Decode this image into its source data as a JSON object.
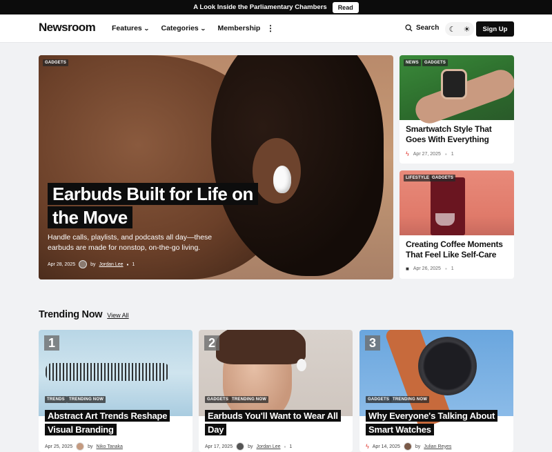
{
  "announcement": {
    "text": "A Look Inside the Parliamentary Chambers",
    "button": "Read"
  },
  "header": {
    "logo": "Newsroom",
    "nav": [
      {
        "label": "Features",
        "has_dropdown": true
      },
      {
        "label": "Categories",
        "has_dropdown": true
      },
      {
        "label": "Membership",
        "has_dropdown": false
      }
    ],
    "more_icon": "more-vertical-icon",
    "search_label": "Search",
    "signup_label": "Sign Up"
  },
  "hero": {
    "tags": [
      "GADGETS"
    ],
    "title": "Earbuds Built for Life on the Move",
    "excerpt": "Handle calls, playlists, and podcasts all day—these earbuds are made for nonstop, on-the-go living.",
    "date": "Apr 28, 2025",
    "by": "by",
    "author": "Jordan Lee",
    "comments": "1"
  },
  "side_cards": [
    {
      "tags": [
        "NEWS",
        "GADGETS"
      ],
      "title": "Smartwatch Style That Goes With Everything",
      "date": "Apr 27, 2025",
      "comments": "1",
      "icon": "bolt-icon"
    },
    {
      "tags": [
        "LIFESTYLE",
        "GADGETS"
      ],
      "title": "Creating Coffee Moments That Feel Like Self-Care",
      "date": "Apr 26, 2025",
      "comments": "1",
      "icon": "lock-icon"
    }
  ],
  "trending": {
    "title": "Trending Now",
    "view_all": "View All",
    "items": [
      {
        "num": "1",
        "tags": [
          "TRENDS",
          "TRENDING NOW"
        ],
        "title": "Abstract Art Trends Reshape Visual Branding",
        "date": "Apr 25, 2025",
        "by": "by",
        "author": "Niko Tanaka"
      },
      {
        "num": "2",
        "tags": [
          "GADGETS",
          "TRENDING NOW"
        ],
        "title": "Earbuds You'll Want to Wear All Day",
        "date": "Apr 17, 2025",
        "by": "by",
        "author": "Jordan Lee",
        "comments": "1"
      },
      {
        "num": "3",
        "tags": [
          "GADGETS",
          "TRENDING NOW"
        ],
        "title": "Why Everyone's Talking About Smart Watches",
        "date": "Apr 14, 2025",
        "by": "by",
        "author": "Julian Reyes"
      }
    ]
  },
  "colors": {
    "background": "#f1f2f4",
    "dark": "#0d0d0d",
    "accent_red": "#e0322a"
  }
}
